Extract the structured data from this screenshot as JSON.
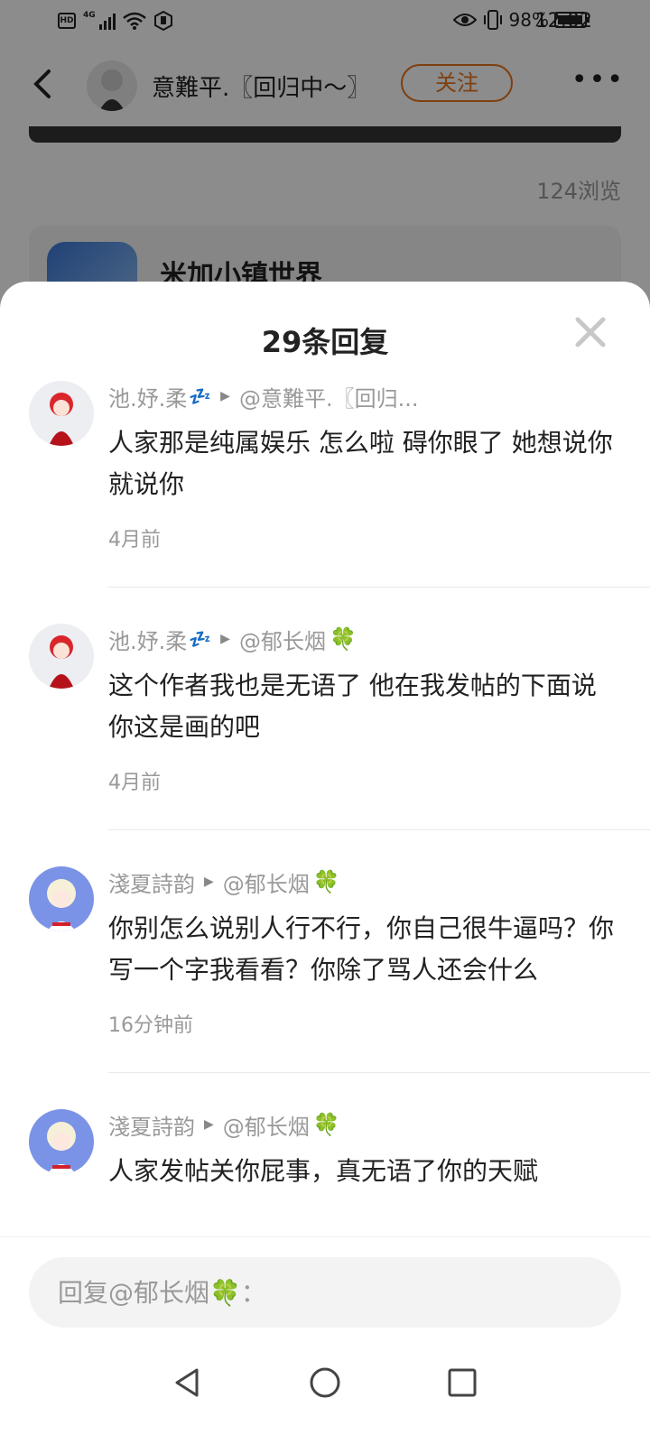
{
  "status_bar": {
    "hd": "HD",
    "network": "4G",
    "battery": "98%",
    "battery_level": 0.98,
    "time": "12:02"
  },
  "header": {
    "author_name": "意難平.〖回归中～〗",
    "follow_label": "关注",
    "more_icon": "more-dots-icon"
  },
  "post": {
    "views": "124浏览",
    "game_name": "米加小镇世界"
  },
  "sheet": {
    "title": "29条回复",
    "replies": [
      {
        "user": "池.妤.柔",
        "user_emoji": "💤",
        "reply_to": "@意難平.〖回归...",
        "text": "人家那是纯属娱乐 怎么啦 碍你眼了 她想说你就说你",
        "time": "4月前"
      },
      {
        "user": "池.妤.柔",
        "user_emoji": "💤",
        "reply_to": "@郁长烟",
        "reply_to_emoji": "🍀",
        "text": "这个作者我也是无语了 他在我发帖的下面说你这是画的吧",
        "time": "4月前"
      },
      {
        "user": "淺夏詩韵",
        "reply_to": "@郁长烟",
        "reply_to_emoji": "🍀",
        "text": "你别怎么说别人行不行，你自己很牛逼吗？你写一个字我看看？你除了骂人还会什么",
        "time": "16分钟前"
      },
      {
        "user": "淺夏詩韵",
        "reply_to": "@郁长烟",
        "reply_to_emoji": "🍀",
        "text": "人家发帖关你屁事，真无语了你的天赋",
        "time": ""
      }
    ],
    "input_placeholder": "回复@郁长烟🍀："
  },
  "colors": {
    "accent": "#e8731a",
    "muted_text": "#999999"
  }
}
